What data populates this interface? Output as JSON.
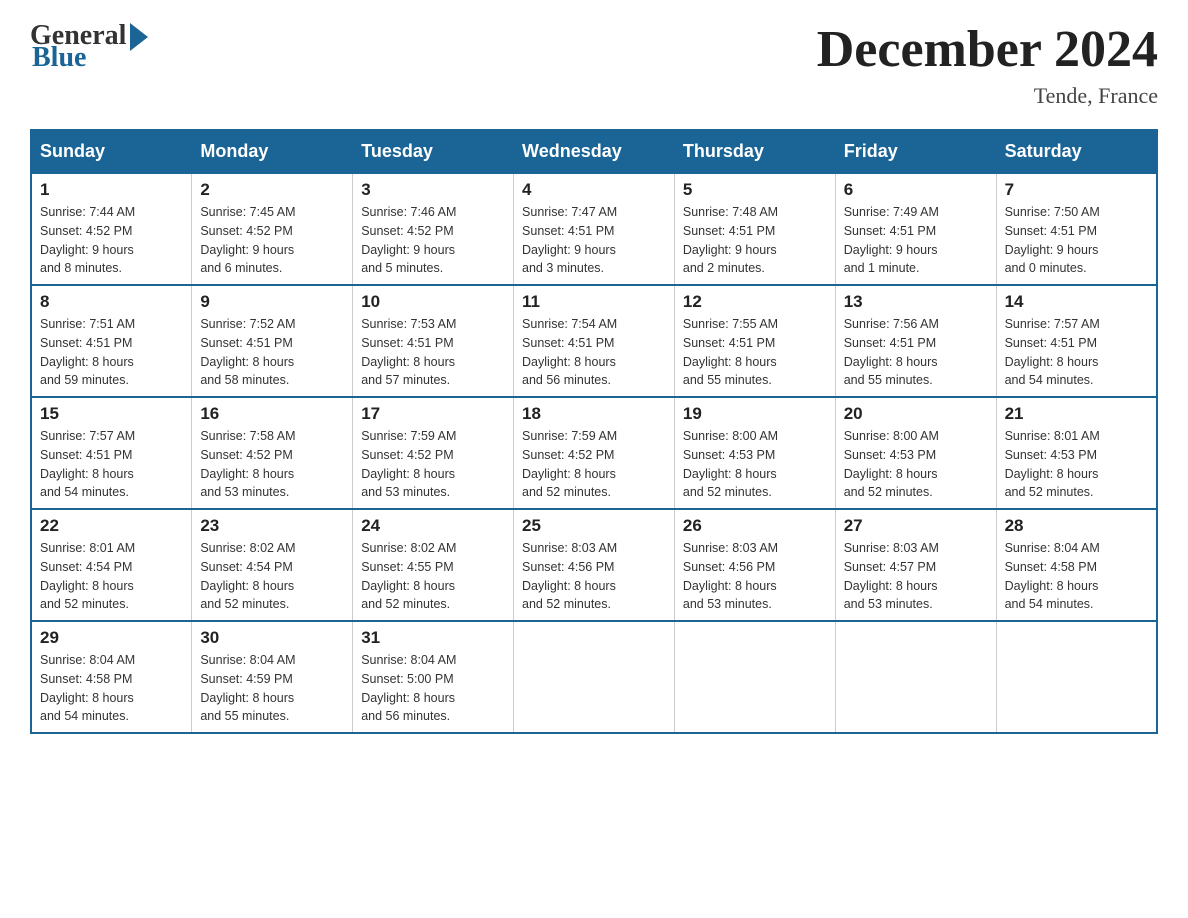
{
  "header": {
    "logo": {
      "general": "General",
      "blue": "Blue"
    },
    "title": "December 2024",
    "location": "Tende, France"
  },
  "days_of_week": [
    "Sunday",
    "Monday",
    "Tuesday",
    "Wednesday",
    "Thursday",
    "Friday",
    "Saturday"
  ],
  "weeks": [
    [
      {
        "day": "1",
        "sunrise": "7:44 AM",
        "sunset": "4:52 PM",
        "daylight": "9 hours and 8 minutes."
      },
      {
        "day": "2",
        "sunrise": "7:45 AM",
        "sunset": "4:52 PM",
        "daylight": "9 hours and 6 minutes."
      },
      {
        "day": "3",
        "sunrise": "7:46 AM",
        "sunset": "4:52 PM",
        "daylight": "9 hours and 5 minutes."
      },
      {
        "day": "4",
        "sunrise": "7:47 AM",
        "sunset": "4:51 PM",
        "daylight": "9 hours and 3 minutes."
      },
      {
        "day": "5",
        "sunrise": "7:48 AM",
        "sunset": "4:51 PM",
        "daylight": "9 hours and 2 minutes."
      },
      {
        "day": "6",
        "sunrise": "7:49 AM",
        "sunset": "4:51 PM",
        "daylight": "9 hours and 1 minute."
      },
      {
        "day": "7",
        "sunrise": "7:50 AM",
        "sunset": "4:51 PM",
        "daylight": "9 hours and 0 minutes."
      }
    ],
    [
      {
        "day": "8",
        "sunrise": "7:51 AM",
        "sunset": "4:51 PM",
        "daylight": "8 hours and 59 minutes."
      },
      {
        "day": "9",
        "sunrise": "7:52 AM",
        "sunset": "4:51 PM",
        "daylight": "8 hours and 58 minutes."
      },
      {
        "day": "10",
        "sunrise": "7:53 AM",
        "sunset": "4:51 PM",
        "daylight": "8 hours and 57 minutes."
      },
      {
        "day": "11",
        "sunrise": "7:54 AM",
        "sunset": "4:51 PM",
        "daylight": "8 hours and 56 minutes."
      },
      {
        "day": "12",
        "sunrise": "7:55 AM",
        "sunset": "4:51 PM",
        "daylight": "8 hours and 55 minutes."
      },
      {
        "day": "13",
        "sunrise": "7:56 AM",
        "sunset": "4:51 PM",
        "daylight": "8 hours and 55 minutes."
      },
      {
        "day": "14",
        "sunrise": "7:57 AM",
        "sunset": "4:51 PM",
        "daylight": "8 hours and 54 minutes."
      }
    ],
    [
      {
        "day": "15",
        "sunrise": "7:57 AM",
        "sunset": "4:51 PM",
        "daylight": "8 hours and 54 minutes."
      },
      {
        "day": "16",
        "sunrise": "7:58 AM",
        "sunset": "4:52 PM",
        "daylight": "8 hours and 53 minutes."
      },
      {
        "day": "17",
        "sunrise": "7:59 AM",
        "sunset": "4:52 PM",
        "daylight": "8 hours and 53 minutes."
      },
      {
        "day": "18",
        "sunrise": "7:59 AM",
        "sunset": "4:52 PM",
        "daylight": "8 hours and 52 minutes."
      },
      {
        "day": "19",
        "sunrise": "8:00 AM",
        "sunset": "4:53 PM",
        "daylight": "8 hours and 52 minutes."
      },
      {
        "day": "20",
        "sunrise": "8:00 AM",
        "sunset": "4:53 PM",
        "daylight": "8 hours and 52 minutes."
      },
      {
        "day": "21",
        "sunrise": "8:01 AM",
        "sunset": "4:53 PM",
        "daylight": "8 hours and 52 minutes."
      }
    ],
    [
      {
        "day": "22",
        "sunrise": "8:01 AM",
        "sunset": "4:54 PM",
        "daylight": "8 hours and 52 minutes."
      },
      {
        "day": "23",
        "sunrise": "8:02 AM",
        "sunset": "4:54 PM",
        "daylight": "8 hours and 52 minutes."
      },
      {
        "day": "24",
        "sunrise": "8:02 AM",
        "sunset": "4:55 PM",
        "daylight": "8 hours and 52 minutes."
      },
      {
        "day": "25",
        "sunrise": "8:03 AM",
        "sunset": "4:56 PM",
        "daylight": "8 hours and 52 minutes."
      },
      {
        "day": "26",
        "sunrise": "8:03 AM",
        "sunset": "4:56 PM",
        "daylight": "8 hours and 53 minutes."
      },
      {
        "day": "27",
        "sunrise": "8:03 AM",
        "sunset": "4:57 PM",
        "daylight": "8 hours and 53 minutes."
      },
      {
        "day": "28",
        "sunrise": "8:04 AM",
        "sunset": "4:58 PM",
        "daylight": "8 hours and 54 minutes."
      }
    ],
    [
      {
        "day": "29",
        "sunrise": "8:04 AM",
        "sunset": "4:58 PM",
        "daylight": "8 hours and 54 minutes."
      },
      {
        "day": "30",
        "sunrise": "8:04 AM",
        "sunset": "4:59 PM",
        "daylight": "8 hours and 55 minutes."
      },
      {
        "day": "31",
        "sunrise": "8:04 AM",
        "sunset": "5:00 PM",
        "daylight": "8 hours and 56 minutes."
      },
      null,
      null,
      null,
      null
    ]
  ],
  "labels": {
    "sunrise": "Sunrise:",
    "sunset": "Sunset:",
    "daylight": "Daylight:"
  }
}
